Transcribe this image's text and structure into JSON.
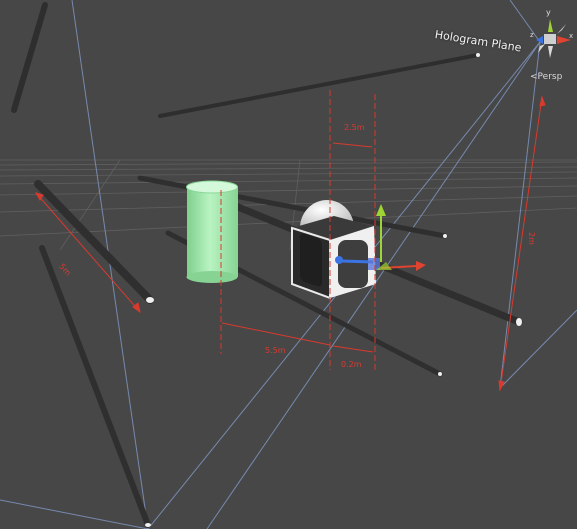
{
  "scene": {
    "plane_label": "Hologram Plane",
    "projection_label": "Persp",
    "projection_chevron": "<",
    "dimension_labels": [
      "2.5m",
      "5.5m",
      "0.2m",
      "5m",
      "2m"
    ]
  },
  "gizmo": {
    "axis_labels": [
      "y",
      "x",
      "z"
    ],
    "colors": {
      "x": "#e0432f",
      "y": "#9ed534",
      "z": "#3b73e3",
      "neutral": "#cfcfcf"
    }
  },
  "colors": {
    "background": "#474747",
    "grid": "#6a6a6a",
    "frustum": "#7f95c0",
    "dimension": "#d93a2e",
    "cylinder": "#9ce6a8",
    "sphere": "#ececec",
    "cube": "#2a2a2a",
    "rods": "#2f2f2f"
  }
}
